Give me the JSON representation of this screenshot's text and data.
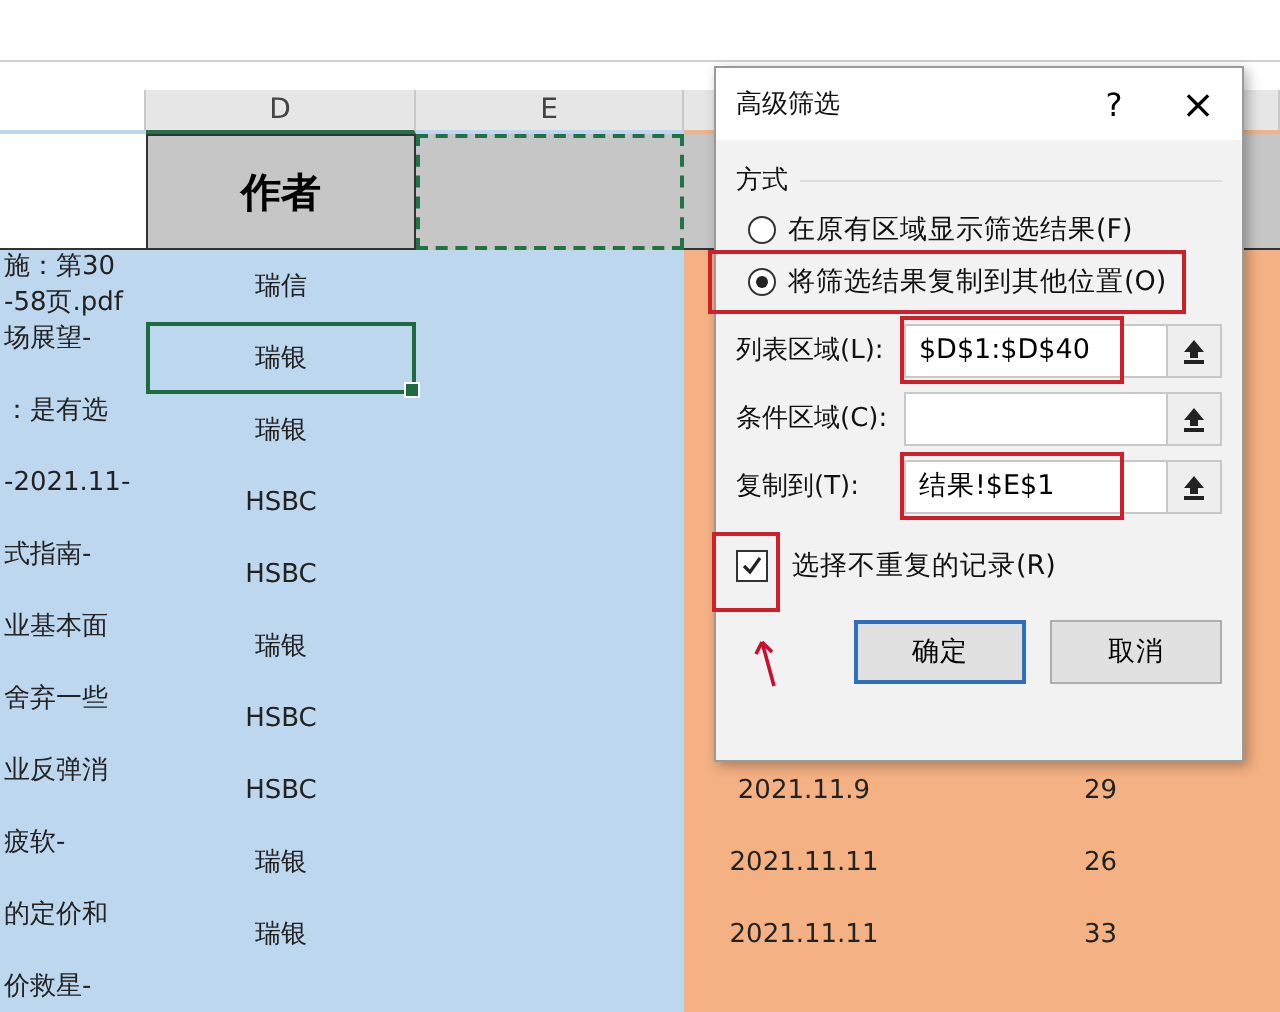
{
  "sheet": {
    "column_headers": [
      {
        "label": "D"
      },
      {
        "label": "E"
      }
    ],
    "header": {
      "author": "作者"
    },
    "rows": [
      {
        "title": "施：第30\n-58页.pdf",
        "author": "瑞信",
        "selected": false
      },
      {
        "title": "场展望-",
        "author": "瑞银",
        "selected": true
      },
      {
        "title": "：是有选",
        "author": "瑞银",
        "selected": false
      },
      {
        "title": "-2021.11-",
        "author": "HSBC",
        "selected": false
      },
      {
        "title": "式指南-",
        "author": "HSBC",
        "selected": false
      },
      {
        "title": "业基本面",
        "author": "瑞银",
        "selected": false
      },
      {
        "title": "舍弃一些",
        "author": "HSBC",
        "selected": false
      },
      {
        "title": "业反弹消",
        "author": "HSBC",
        "selected": false,
        "date": "2021.11.9",
        "count": "29"
      },
      {
        "title": "疲软-",
        "author": "瑞银",
        "selected": false,
        "date": "2021.11.11",
        "count": "26"
      },
      {
        "title": "的定价和",
        "author": "瑞银",
        "selected": false,
        "date": "2021.11.11",
        "count": "33"
      },
      {
        "title": "价救星-",
        "selected": false
      }
    ]
  },
  "dialog": {
    "title": "高级筛选",
    "help": "?",
    "close": "×",
    "group": "方式",
    "options": [
      {
        "label": "在原有区域显示筛选结果(F)",
        "selected": false,
        "highlighted": false
      },
      {
        "label": "将筛选结果复制到其他位置(O)",
        "selected": true,
        "highlighted": true
      }
    ],
    "fields": [
      {
        "label": "列表区域(L):",
        "value": "$D$1:$D$40",
        "highlighted": true
      },
      {
        "label": "条件区域(C):",
        "highlighted": false
      },
      {
        "label": "复制到(T):",
        "value": "结果!$E$1",
        "highlighted": true
      }
    ],
    "checkbox": {
      "label": "选择不重复的记录(R)",
      "checked": true,
      "highlighted": true
    },
    "buttons": [
      {
        "label": "确定",
        "default": true
      },
      {
        "label": "取消",
        "default": false
      }
    ]
  }
}
